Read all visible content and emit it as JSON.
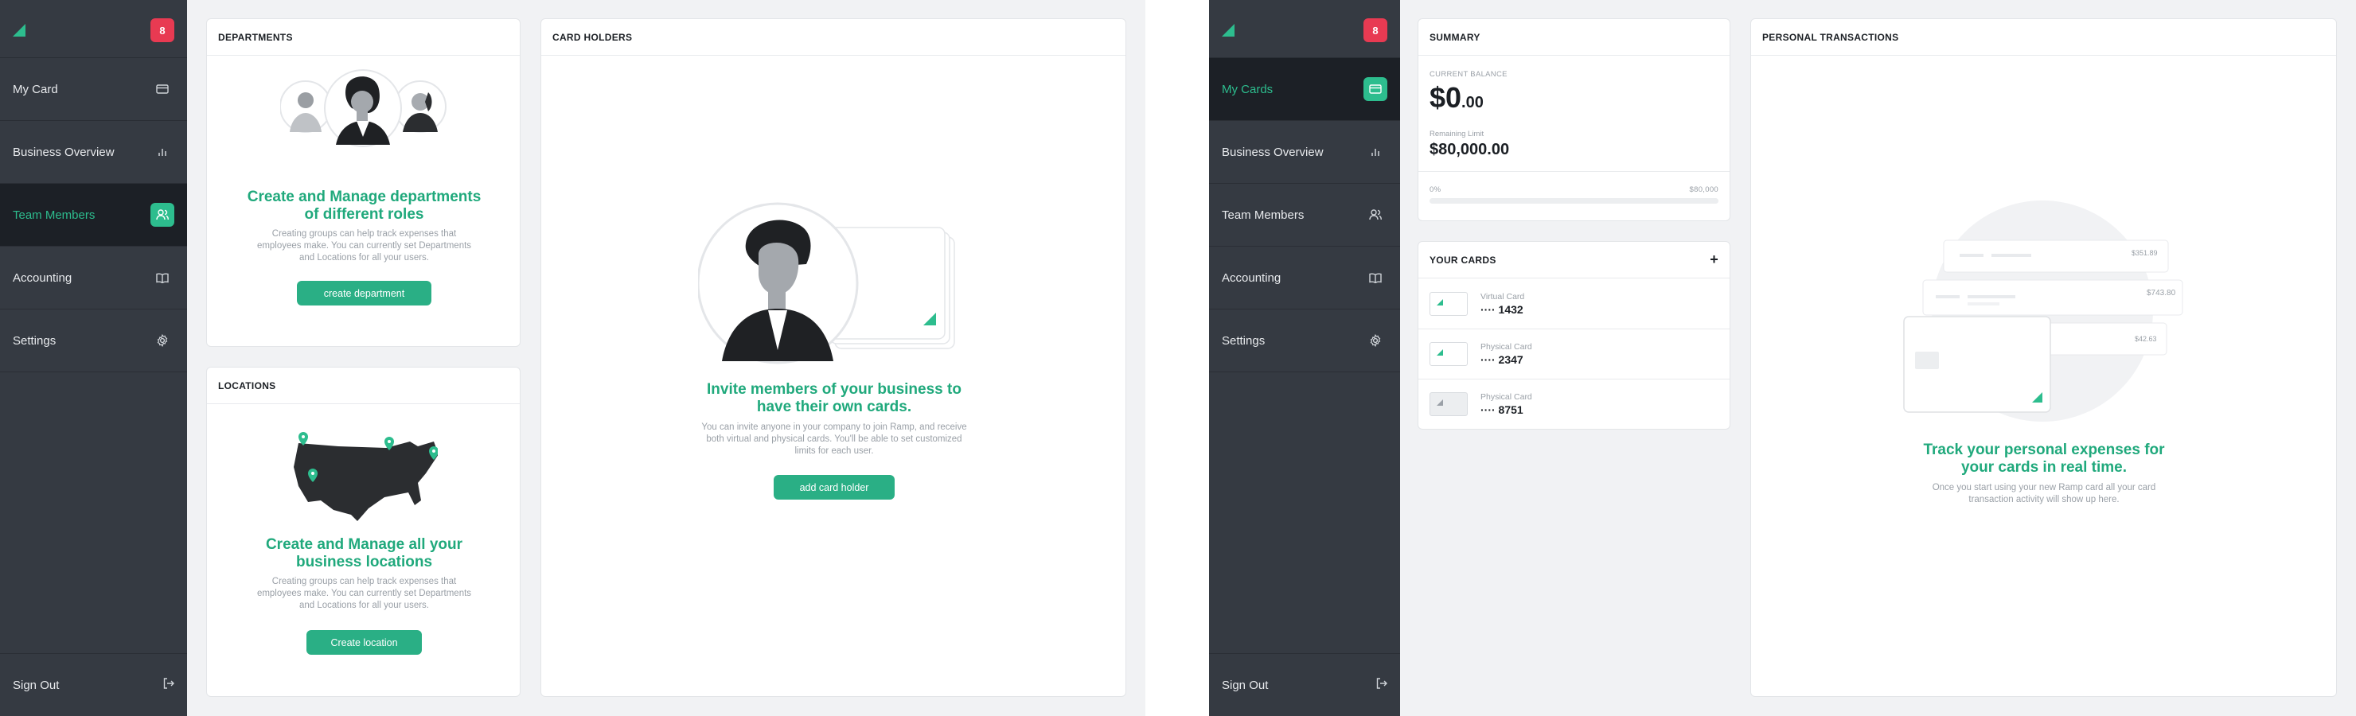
{
  "colors": {
    "sidebar": "#353a42",
    "accent": "#2dbd8e",
    "badge": "#e83a52",
    "background": "#f1f2f4"
  },
  "screen_a": {
    "badge": "8",
    "nav": [
      {
        "label": "My Card",
        "icon": "credit-card-icon"
      },
      {
        "label": "Business Overview",
        "icon": "bar-chart-icon"
      },
      {
        "label": "Team Members",
        "icon": "users-icon",
        "active": true
      },
      {
        "label": "Accounting",
        "icon": "book-icon"
      },
      {
        "label": "Settings",
        "icon": "gear-icon"
      }
    ],
    "sign_out": "Sign Out",
    "departments": {
      "header": "DEPARTMENTS",
      "title": "Create and Manage departments of different roles",
      "text": "Creating groups can help track expenses that employees make. You can currently set Departments and Locations for all your users.",
      "button": "create department"
    },
    "locations": {
      "header": "LOCATIONS",
      "title": "Create and Manage all your business locations",
      "text": "Creating groups can help track expenses that employees make. You can currently set Departments and Locations for all your users.",
      "button": "Create location"
    },
    "card_holders": {
      "header": "CARD HOLDERS",
      "title": "Invite members of your business to have their own cards.",
      "text": "You can invite anyone in your company to join Ramp, and receive both virtual and physical cards. You'll be able to set customized limits for each user.",
      "button": "add card holder"
    }
  },
  "screen_b": {
    "badge": "8",
    "nav": [
      {
        "label": "My Cards",
        "icon": "credit-card-icon",
        "active": true
      },
      {
        "label": "Business Overview",
        "icon": "bar-chart-icon"
      },
      {
        "label": "Team Members",
        "icon": "users-icon"
      },
      {
        "label": "Accounting",
        "icon": "book-icon"
      },
      {
        "label": "Settings",
        "icon": "gear-icon"
      }
    ],
    "sign_out": "Sign Out",
    "summary": {
      "header": "SUMMARY",
      "balance_label": "CURRENT BALANCE",
      "balance_main": "$0",
      "balance_cents": ".00",
      "limit_label": "Remaining Limit",
      "limit_value": "$80,000.00",
      "progress_min": "0%",
      "progress_max": "$80,000",
      "progress_fraction": 0
    },
    "your_cards": {
      "header": "YOUR CARDS",
      "add": "+",
      "items": [
        {
          "label": "Virtual Card",
          "number": "···· 1432"
        },
        {
          "label": "Physical Card",
          "number": "···· 2347"
        },
        {
          "label": "Physical Card",
          "number": "···· 8751"
        }
      ]
    },
    "personal_transactions": {
      "header": "PERSONAL TRANSACTIONS",
      "amounts": [
        "$351.89",
        "$743.80",
        "$42.63"
      ],
      "title": "Track your personal expenses for your cards in real time.",
      "text": "Once you start using your new Ramp card all your card transaction activity will show up here."
    }
  }
}
